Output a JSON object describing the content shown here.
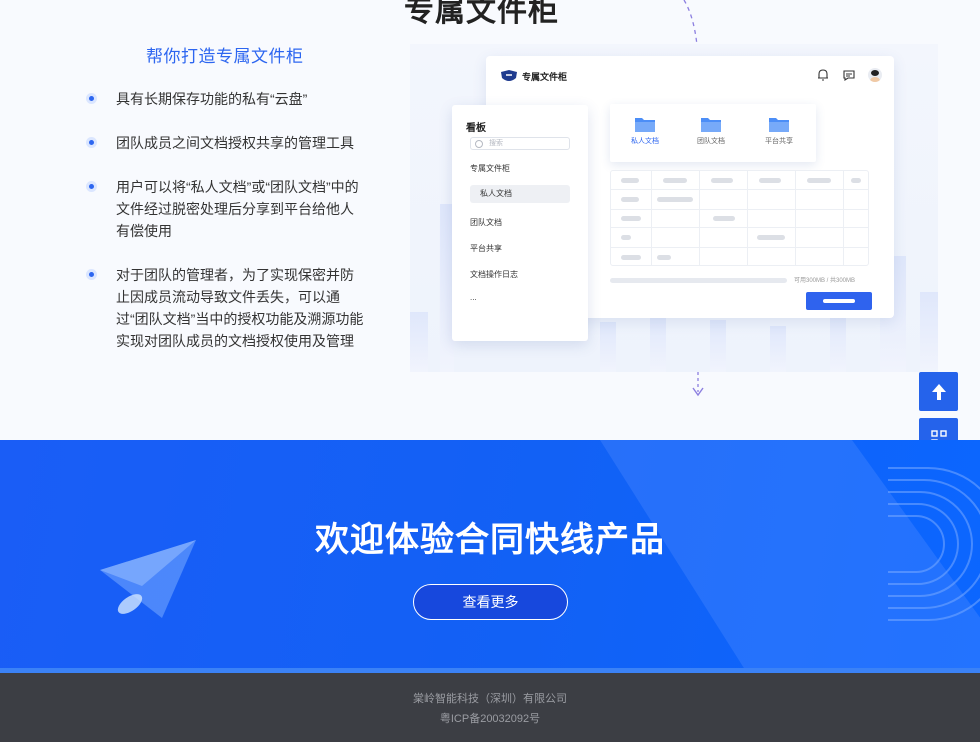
{
  "feature": {
    "section_heading": "专属文件柜",
    "subtitle": "帮你打造专属文件柜",
    "bullets": [
      "具有长期保存功能的私有“云盘”",
      "团队成员之间文档授权共享的管理工具",
      "用户可以将“私人文档”或“团队文档”中的文件经过脱密处理后分享到平台给他人有偿使用",
      "对于团队的管理者，为了实现保密并防止因成员流动导致文件丢失，可以通过“团队文档”当中的授权功能及溯源功能实现对团队成员的文档授权使用及管理"
    ],
    "mock_app": {
      "window_title": "专属文件柜",
      "sidebar_heading": "看板",
      "search_placeholder": "搜索",
      "sidebar_items": [
        "专属文件柜",
        "私人文档",
        "团队文档",
        "平台共享",
        "文档操作日志",
        "..."
      ],
      "folders": [
        "私人文档",
        "团队文档",
        "平台共享"
      ],
      "quota_text": "可用300MB / 共300MB"
    }
  },
  "cta": {
    "title": "欢迎体验合同快线产品",
    "button_label": "查看更多"
  },
  "footer": {
    "company": "棠岭智能科技（深圳）有限公司",
    "icp": "粤ICP备20032092号"
  },
  "icons": {
    "float_up": "arrow-up-icon",
    "float_qr": "qr-code-icon"
  },
  "colors": {
    "accent": "#2d66f0",
    "cta_blue": "#1261f5",
    "footer_bg": "#3c3e44"
  }
}
